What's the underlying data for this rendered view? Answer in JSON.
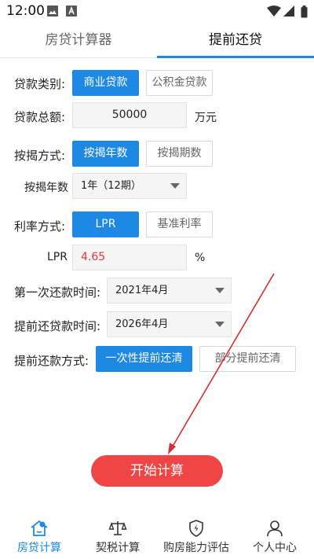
{
  "status_bar": {
    "time": "12:00"
  },
  "tabs": [
    {
      "label": "房贷计算器",
      "active": false
    },
    {
      "label": "提前还贷",
      "active": true
    }
  ],
  "form": {
    "loan_type": {
      "label": "贷款类别:",
      "options": [
        "商业贷款",
        "公积金贷款"
      ],
      "selected": "商业贷款"
    },
    "loan_total": {
      "label": "贷款总额:",
      "value": "50000",
      "unit": "万元"
    },
    "mortgage_mode": {
      "label": "按揭方式:",
      "options": [
        "按揭年数",
        "按揭期数"
      ],
      "selected": "按揭年数"
    },
    "mortgage_years": {
      "label": "按揭年数",
      "value": "1年（12期）"
    },
    "rate_mode": {
      "label": "利率方式:",
      "options": [
        "LPR",
        "基准利率"
      ],
      "selected": "LPR"
    },
    "lpr": {
      "label": "LPR",
      "value": "4.65",
      "unit": "%"
    },
    "first_repay": {
      "label": "第一次还款时间:",
      "value": "2021年4月"
    },
    "prepay_time": {
      "label": "提前还贷款时间:",
      "value": "2026年4月"
    },
    "prepay_mode": {
      "label": "提前还款方式:",
      "options": [
        "一次性提前还清",
        "部分提前还清"
      ],
      "selected": "一次性提前还清"
    }
  },
  "start_button": "开始计算",
  "bottom_nav": [
    {
      "label": "房贷计算",
      "icon": "house-icon",
      "active": true
    },
    {
      "label": "契税计算",
      "icon": "scale-icon",
      "active": false
    },
    {
      "label": "购房能力评估",
      "icon": "shield-bolt-icon",
      "active": false
    },
    {
      "label": "个人中心",
      "icon": "person-icon",
      "active": false
    }
  ],
  "colors": {
    "accent": "#1e88e5",
    "start": "#ef4545",
    "annotation_arrow": "#d32f2f",
    "lpr_value": "#e53935"
  }
}
